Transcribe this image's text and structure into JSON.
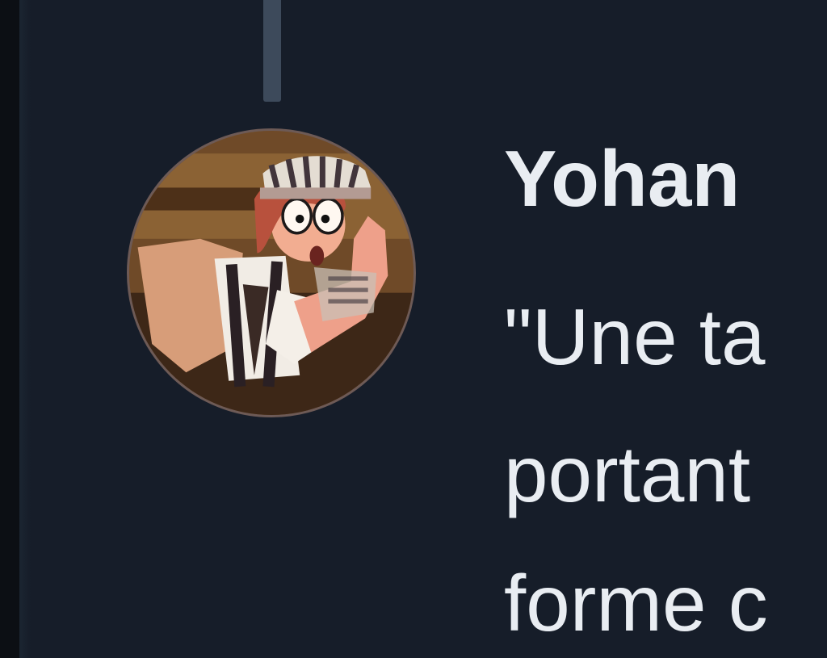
{
  "tweet": {
    "author": {
      "display_name": "Yohan",
      "avatar_icon": "cartoon-character-avatar"
    },
    "text_lines": [
      "\"Une ta",
      "portant",
      "forme c"
    ]
  },
  "theme": {
    "background": "#161d29",
    "text_color": "#e9edf2",
    "thread_line_color": "#3d4a5b"
  }
}
